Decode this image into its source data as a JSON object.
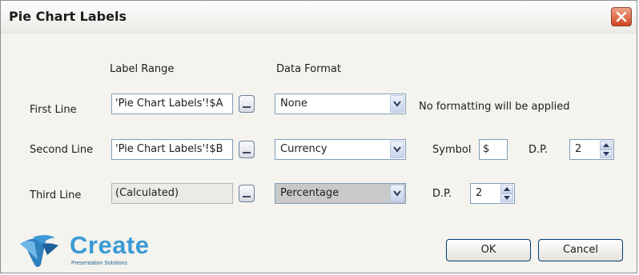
{
  "window": {
    "title": "Pie Chart Labels"
  },
  "headers": {
    "label_range": "Label Range",
    "data_format": "Data Format"
  },
  "rows": [
    {
      "label": "First Line",
      "range": "'Pie Chart Labels'!$A",
      "format": "None",
      "note": "No formatting will be applied"
    },
    {
      "label": "Second Line",
      "range": "'Pie Chart Labels'!$B",
      "format": "Currency",
      "symbol_label": "Symbol",
      "symbol": "$",
      "dp_label": "D.P.",
      "dp": "2"
    },
    {
      "label": "Third Line",
      "range": "(Calculated)",
      "format": "Percentage",
      "dp_label": "D.P.",
      "dp": "2"
    }
  ],
  "buttons": {
    "ok": "OK",
    "cancel": "Cancel"
  },
  "logo": {
    "name": "Create",
    "tagline": "Presentation Solutions"
  },
  "colors": {
    "close": "#d0451f",
    "logo": "#3b9ad6"
  }
}
